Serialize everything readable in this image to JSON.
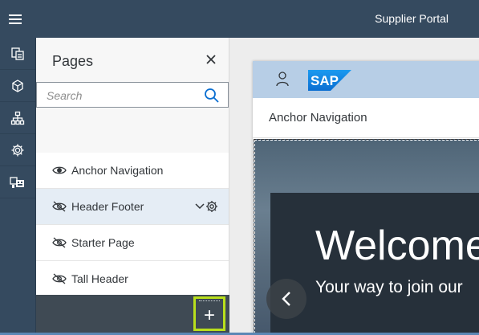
{
  "header": {
    "title": "Supplier Portal",
    "menu_icon": "hamburger-icon"
  },
  "rail": {
    "items": [
      {
        "name": "pages",
        "icon": "pages-icon"
      },
      {
        "name": "apps",
        "icon": "cube-icon"
      },
      {
        "name": "hierarchy",
        "icon": "sitemap-icon"
      },
      {
        "name": "settings",
        "icon": "gear-icon"
      },
      {
        "name": "transport",
        "icon": "transport-icon"
      }
    ]
  },
  "pages_panel": {
    "title": "Pages",
    "search_placeholder": "Search",
    "items": [
      {
        "label": "Anchor Navigation",
        "visibility": "visible",
        "selected": false
      },
      {
        "label": "Header Footer",
        "visibility": "hidden",
        "selected": true
      },
      {
        "label": "Starter Page",
        "visibility": "hidden",
        "selected": false
      },
      {
        "label": "Tall Header",
        "visibility": "hidden",
        "selected": false
      }
    ],
    "add_label": "+"
  },
  "preview": {
    "logo_text": "SAP",
    "anchor_nav_label": "Anchor Navigation",
    "hero_title": "Welcome",
    "hero_subtitle": "Your way to join our"
  },
  "colors": {
    "shell_bg": "#354a5f",
    "selected_row": "#e5edf5",
    "add_highlight": "#b9df1c",
    "sap_blue": "#0a6ed1"
  }
}
